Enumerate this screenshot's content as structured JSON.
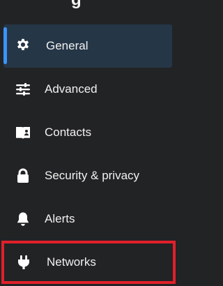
{
  "header": {
    "title_fragment": "g"
  },
  "menu": {
    "items": [
      {
        "label": "General",
        "icon": "gear-icon",
        "state": "active"
      },
      {
        "label": "Advanced",
        "icon": "sliders-icon",
        "state": "default"
      },
      {
        "label": "Contacts",
        "icon": "address-book-icon",
        "state": "default"
      },
      {
        "label": "Security & privacy",
        "icon": "lock-icon",
        "state": "default"
      },
      {
        "label": "Alerts",
        "icon": "bell-icon",
        "state": "default"
      },
      {
        "label": "Networks",
        "icon": "plug-icon",
        "state": "highlighted"
      }
    ]
  },
  "colors": {
    "background": "#222325",
    "active_background": "#253647",
    "active_indicator": "#3a94ff",
    "highlight_border": "#e0202a",
    "text": "#f1f1f1"
  }
}
